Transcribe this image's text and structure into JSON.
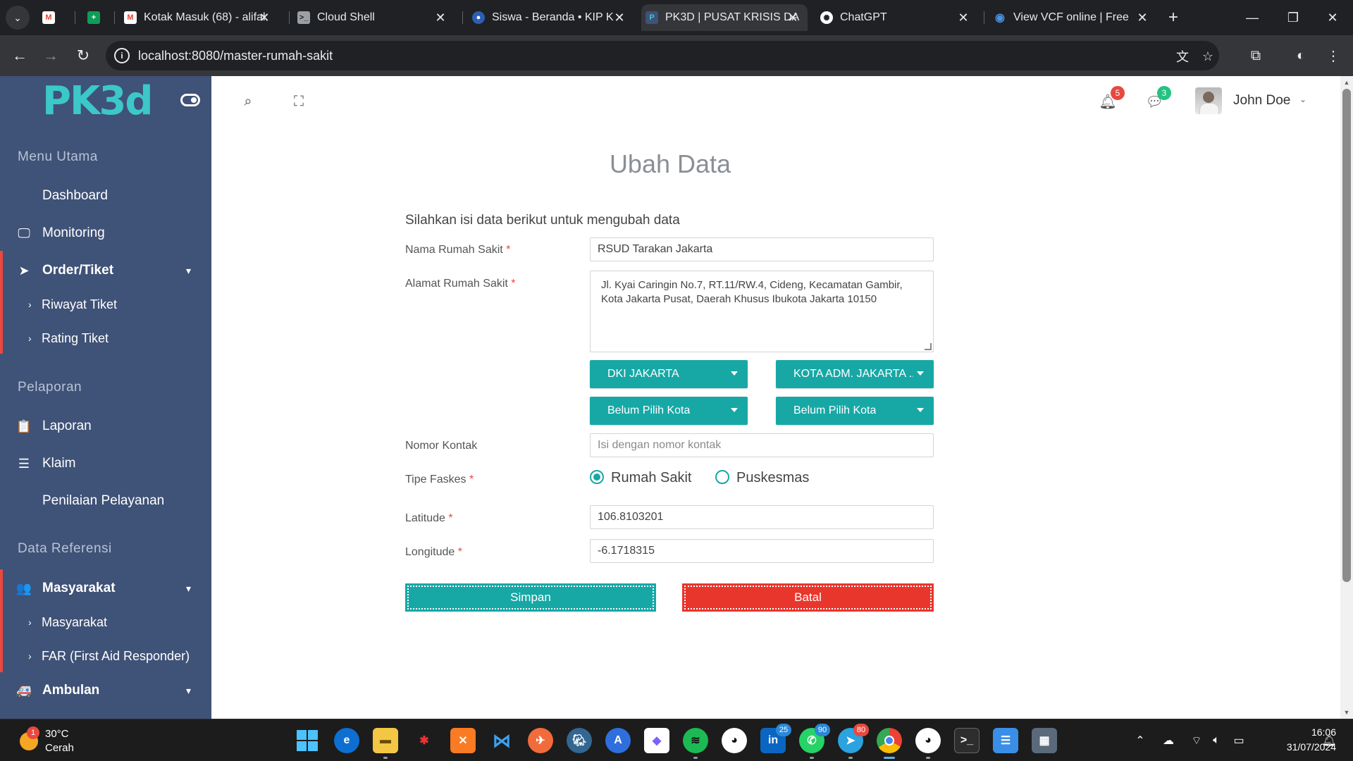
{
  "browser": {
    "tabs": [
      {
        "title": "",
        "icon": "gmail-icon",
        "active": false
      },
      {
        "title": "",
        "icon": "sheets-icon",
        "active": false
      },
      {
        "title": "Kotak Masuk (68) - alifal",
        "icon": "gmail-icon",
        "active": false
      },
      {
        "title": "Cloud Shell",
        "icon": "cloud-shell-icon",
        "active": false
      },
      {
        "title": "Siswa - Beranda • KIP K",
        "icon": "kip-icon",
        "active": false
      },
      {
        "title": "PK3D | PUSAT KRISIS DA",
        "icon": "pk3d-icon",
        "active": true
      },
      {
        "title": "ChatGPT",
        "icon": "chatgpt-icon",
        "active": false
      },
      {
        "title": "View VCF online | Free",
        "icon": "eye-icon",
        "active": false
      }
    ],
    "url": "localhost:8080/master-rumah-sakit"
  },
  "sidebar": {
    "logo": "PK3d",
    "sections": {
      "main": "Menu Utama",
      "report": "Pelaporan",
      "reference": "Data Referensi"
    },
    "items": {
      "dashboard": "Dashboard",
      "monitoring": "Monitoring",
      "order": "Order/Tiket",
      "riwayat": "Riwayat Tiket",
      "rating": "Rating Tiket",
      "laporan": "Laporan",
      "klaim": "Klaim",
      "penilaian": "Penilaian Pelayanan",
      "masyarakat_group": "Masyarakat",
      "masyarakat": "Masyarakat",
      "far": "FAR (First Aid Responder)",
      "ambulan": "Ambulan"
    }
  },
  "header": {
    "notifications_count": "5",
    "messages_count": "3",
    "user_name": "John Doe"
  },
  "form": {
    "title": "Ubah Data",
    "intro": "Silahkan isi data berikut untuk mengubah data",
    "required_mark": "*",
    "nama_label": "Nama Rumah Sakit",
    "nama_value": "RSUD Tarakan Jakarta",
    "alamat_label": "Alamat Rumah Sakit",
    "alamat_value": "Jl. Kyai Caringin No.7, RT.11/RW.4, Cideng, Kecamatan Gambir, Kota Jakarta Pusat, Daerah Khusus Ibukota Jakarta 10150",
    "provinsi": "DKI JAKARTA",
    "kota": "KOTA ADM. JAKARTA ...",
    "kecamatan": "Belum Pilih Kota",
    "kelurahan": "Belum Pilih Kota",
    "kontak_label": "Nomor Kontak",
    "kontak_placeholder": "Isi dengan nomor kontak",
    "tipe_label": "Tipe Faskes",
    "tipe_options": [
      "Rumah Sakit",
      "Puskesmas"
    ],
    "tipe_selected": "Rumah Sakit",
    "lat_label": "Latitude",
    "lat_value": "106.8103201",
    "lng_label": "Longitude",
    "lng_value": "-6.1718315",
    "save_label": "Simpan",
    "cancel_label": "Batal"
  },
  "taskbar": {
    "weather_temp": "30°C",
    "weather_desc": "Cerah",
    "weather_badge": "1",
    "linkedin_badge": "25",
    "whatsapp_badge": "90",
    "telegram_badge": "80",
    "time": "16:06",
    "date": "31/07/2024"
  },
  "colors": {
    "sidebar_bg": "#3f5277",
    "teal": "#17a8a6",
    "red": "#e9362c"
  }
}
